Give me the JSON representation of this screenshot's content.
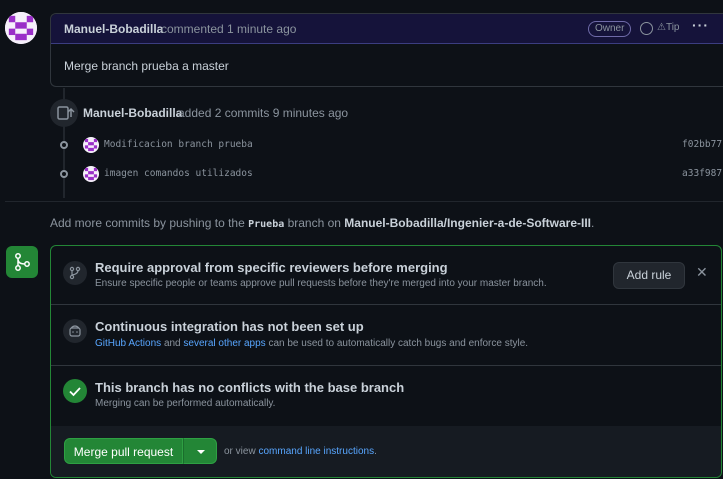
{
  "comment": {
    "author": "Manuel-Bobadilla",
    "action": "commented 1 minute ago",
    "badge": "Owner",
    "tip_label": "Tip",
    "more_label": "···",
    "body": "Merge branch prueba a master"
  },
  "event": {
    "author": "Manuel-Bobadilla",
    "action": "added 2 commits 9 minutes ago"
  },
  "commits": [
    {
      "message": "Modificacion branch prueba",
      "sha": "f02bb77"
    },
    {
      "message": "imagen comandos utilizados",
      "sha": "a33f987"
    }
  ],
  "push_hint": {
    "prefix": "Add more commits by pushing to the",
    "branch": "Prueba",
    "middle": "branch on",
    "repo": "Manuel-Bobadilla/Ingenier-a-de-Software-III",
    "suffix": "."
  },
  "merge": {
    "review": {
      "title": "Require approval from specific reviewers before merging",
      "subtitle": "Ensure specific people or teams approve pull requests before they're merged into your master branch.",
      "add_rule": "Add rule",
      "close": "✕"
    },
    "ci": {
      "title": "Continuous integration has not been set up",
      "link1": "GitHub Actions",
      "and": "and",
      "link2": "several other apps",
      "rest": "can be used to automatically catch bugs and enforce style."
    },
    "conflicts": {
      "title": "This branch has no conflicts with the base branch",
      "subtitle": "Merging can be performed automatically."
    },
    "button": "Merge pull request",
    "view_prefix": "or view",
    "view_link": "command line instructions",
    "view_suffix": "."
  },
  "colors": {
    "accent_green": "#238636",
    "link_blue": "#58a6ff",
    "comment_header": "#15133a"
  }
}
